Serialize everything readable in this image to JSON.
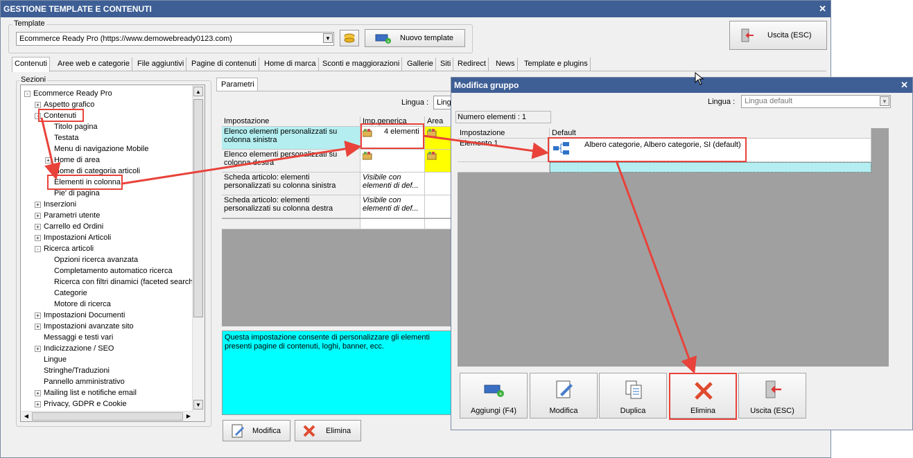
{
  "window": {
    "title": "GESTIONE TEMPLATE E CONTENUTI"
  },
  "template_group": {
    "label": "Template",
    "selected": "Ecommerce Ready Pro (https://www.demowebready0123.com)",
    "new_button": "Nuovo template",
    "exit_button": "Uscita (ESC)"
  },
  "tabs": [
    "Contenuti",
    "Aree web e categorie",
    "File aggiuntivi",
    "Pagine di contenuti",
    "Home di marca",
    "Sconti e maggiorazioni",
    "Gallerie",
    "Siti",
    "Redirect",
    "News",
    "Template e plugins"
  ],
  "sections": {
    "label": "Sezioni",
    "tree": [
      {
        "label": "Ecommerce Ready Pro",
        "level": 0,
        "expander": "-"
      },
      {
        "label": "Aspetto grafico",
        "level": 1,
        "expander": "+"
      },
      {
        "label": "Contenuti",
        "level": 1,
        "expander": "-"
      },
      {
        "label": "Titolo pagina",
        "level": 2,
        "expander": ""
      },
      {
        "label": "Testata",
        "level": 2,
        "expander": ""
      },
      {
        "label": "Menu di navigazione Mobile",
        "level": 2,
        "expander": ""
      },
      {
        "label": "Home di area",
        "level": 2,
        "expander": "+"
      },
      {
        "label": "Home di categoria articoli",
        "level": 2,
        "expander": ""
      },
      {
        "label": "Elementi in colonna",
        "level": 2,
        "expander": ""
      },
      {
        "label": "Pie' di pagina",
        "level": 2,
        "expander": ""
      },
      {
        "label": "Inserzioni",
        "level": 1,
        "expander": "+"
      },
      {
        "label": "Parametri utente",
        "level": 1,
        "expander": "+"
      },
      {
        "label": "Carrello ed Ordini",
        "level": 1,
        "expander": "+"
      },
      {
        "label": "Impostazioni Articoli",
        "level": 1,
        "expander": "+"
      },
      {
        "label": "Ricerca articoli",
        "level": 1,
        "expander": "-"
      },
      {
        "label": "Opzioni ricerca avanzata",
        "level": 2,
        "expander": ""
      },
      {
        "label": "Completamento automatico ricerca",
        "level": 2,
        "expander": ""
      },
      {
        "label": "Ricerca con filtri dinamici (faceted search)",
        "level": 2,
        "expander": ""
      },
      {
        "label": "Categorie",
        "level": 2,
        "expander": ""
      },
      {
        "label": "Motore di ricerca",
        "level": 2,
        "expander": ""
      },
      {
        "label": "Impostazioni Documenti",
        "level": 1,
        "expander": "+"
      },
      {
        "label": "Impostazioni avanzate sito",
        "level": 1,
        "expander": "+"
      },
      {
        "label": "Messaggi e testi vari",
        "level": 1,
        "expander": ""
      },
      {
        "label": "Indicizzazione / SEO",
        "level": 1,
        "expander": "+"
      },
      {
        "label": "Lingue",
        "level": 1,
        "expander": ""
      },
      {
        "label": "Stringhe/Traduzioni",
        "level": 1,
        "expander": ""
      },
      {
        "label": "Pannello amministrativo",
        "level": 1,
        "expander": ""
      },
      {
        "label": "Mailing list e notifiche email",
        "level": 1,
        "expander": "+"
      },
      {
        "label": "Privacy, GDPR e Cookie",
        "level": 1,
        "expander": "+"
      }
    ]
  },
  "params": {
    "tab": "Parametri",
    "lingua_label": "Lingua :",
    "lingua_value": "Lingu",
    "col_impostazione": "Impostazione",
    "col_generica": "Imp.generica",
    "col_area": "Area w",
    "rows": [
      {
        "setting": "Elenco elementi personalizzati su colonna sinistra",
        "value": "4 elementi"
      },
      {
        "setting": "Elenco elementi personalizzati su colonna destra",
        "value": ""
      },
      {
        "setting": "Scheda articolo: elementi personalizzati su colonna sinistra",
        "value": "Visibile con elementi di def..."
      },
      {
        "setting": "Scheda articolo: elementi personalizzati su colonna destra",
        "value": "Visibile con elementi di def..."
      }
    ],
    "description": "Questa impostazione consente di personalizzare gli elementi presenti pagine di contenuti, loghi, banner, ecc.",
    "modify_button": "Modifica",
    "delete_button": "Elimina"
  },
  "dialog": {
    "title": "Modifica gruppo",
    "lingua_label": "Lingua :",
    "lingua_value": "Lingua default",
    "count_label": "Numero elementi : 1",
    "col_impostazione": "Impostazione",
    "col_default": "Default",
    "row_label": "Elemento 1",
    "row_value": "Albero categorie, Albero categorie, SI (default)",
    "buttons": {
      "add": "Aggiungi (F4)",
      "modify": "Modifica",
      "duplicate": "Duplica",
      "delete": "Elimina",
      "exit": "Uscita (ESC)"
    }
  },
  "colors": {
    "titlebar": "#3e5f95",
    "highlight": "#e8423a",
    "cyan": "#00ffff",
    "yellow": "#ffff00",
    "selected_row": "#b4eef0"
  }
}
